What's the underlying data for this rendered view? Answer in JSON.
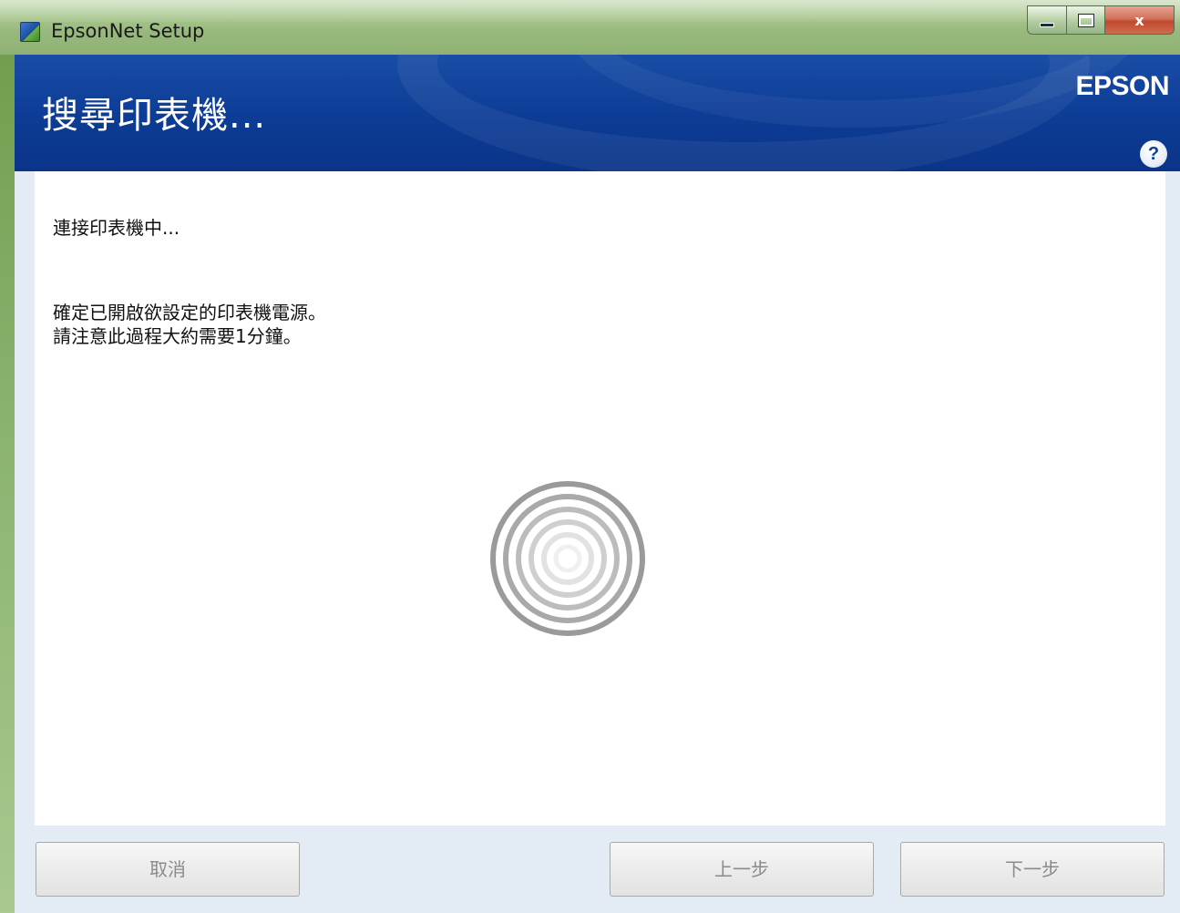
{
  "window": {
    "title": "EpsonNet Setup",
    "caption": {
      "close_glyph": "x"
    }
  },
  "header": {
    "title": "搜尋印表機...",
    "brand": "EPSON",
    "help_glyph": "?"
  },
  "content": {
    "status": "連接印表機中...",
    "instructions": [
      "確定已開啟欲設定的印表機電源。",
      "請注意此過程大約需要1分鐘。"
    ]
  },
  "buttons": {
    "cancel": "取消",
    "back": "上一步",
    "next": "下一步"
  },
  "colors": {
    "header_blue": "#0d3d97",
    "panel_bg": "#e3ebf5",
    "disabled_text": "#8a8a8a"
  },
  "icons": {
    "app": "epsonnet-app-icon",
    "help": "help-icon",
    "busy": "loading-spinner-icon"
  }
}
